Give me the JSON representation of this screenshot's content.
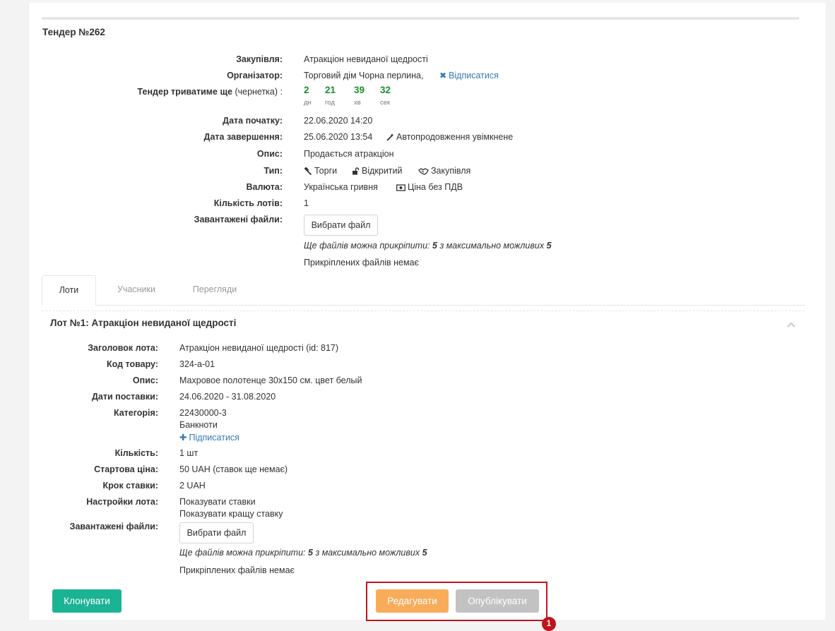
{
  "tender": {
    "title": "Тендер №262",
    "fields": {
      "purchase_label": "Закупівля:",
      "purchase_value": "Атракціон невиданої щедрості",
      "organizer_label": "Організатор:",
      "organizer_value": "Торговий дім Чорна перлина,",
      "unsubscribe_link": "Відписатися",
      "duration_label": "Тендер триватиме ще",
      "duration_suffix": "(чернетка) :",
      "start_label": "Дата початку:",
      "start_value": "22.06.2020 14:20",
      "end_label": "Дата завершення:",
      "end_value": "25.06.2020 13:54",
      "auto_extend": "Автопродовження увімкнене",
      "description_label": "Опис:",
      "description_value": "Продається атракціон",
      "type_label": "Тип:",
      "type_trade": "Торги",
      "type_open": "Відкритий",
      "type_purchase": "Закупівля",
      "currency_label": "Валюта:",
      "currency_value": "Українська гривня",
      "vat": "Ціна без ПДВ",
      "lots_count_label": "Кількість лотів:",
      "lots_count_value": "1",
      "files_label": "Завантажені файли:",
      "choose_file": "Вибрати файл",
      "files_note_prefix": "Ще файлів можна прикріпити:",
      "files_note_count": "5",
      "files_note_mid": "з максимально можливих",
      "files_note_max": "5",
      "no_files": "Прикріплених файлів немає"
    },
    "countdown": [
      {
        "value": "2",
        "unit": "дн"
      },
      {
        "value": "21",
        "unit": "год"
      },
      {
        "value": "39",
        "unit": "хв"
      },
      {
        "value": "32",
        "unit": "сек"
      }
    ]
  },
  "tabs": [
    "Лоти",
    "Учасники",
    "Перегляди"
  ],
  "lot": {
    "title": "Лот №1: Атракціон невиданої щедрості",
    "header_label": "Заголовок лота:",
    "header_value": "Атракціон невиданої щедрості (id: 817)",
    "code_label": "Код товару:",
    "code_value": "324-а-01",
    "description_label": "Опис:",
    "description_value": "Махровое полотенце 30x150 см. цвет белый",
    "delivery_label": "Дати поставки:",
    "delivery_value": "24.06.2020 - 31.08.2020",
    "category_label": "Категорія:",
    "category_code": "22430000-3",
    "category_name": "Банкноти",
    "subscribe_link": "Підписатися",
    "quantity_label": "Кількість:",
    "quantity_value": "1 шт",
    "start_price_label": "Стартова ціна:",
    "start_price_value": "50 UAH (ставок ще немає)",
    "step_label": "Крок ставки:",
    "step_value": "2 UAH",
    "settings_label": "Настройки лота:",
    "settings_1": "Показувати ставки",
    "settings_2": "Показувати кращу ставку",
    "files_label": "Завантажені файли:",
    "choose_file": "Вибрати файл",
    "files_note_prefix": "Ще файлів можна прикріпити:",
    "files_note_count": "5",
    "files_note_mid": "з максимально можливих",
    "files_note_max": "5",
    "no_files": "Прикріплених файлів немає"
  },
  "actions": {
    "clone": "Клонувати",
    "edit": "Редагувати",
    "publish": "Опублікувати",
    "badge": "1"
  },
  "colors": {
    "green_button": "#1ab394",
    "orange_button": "#f8ac59",
    "gray_button": "#c2c2c2",
    "highlight": "#c0141c",
    "countdown_green": "#1e8c2e",
    "link": "#337ab7"
  }
}
